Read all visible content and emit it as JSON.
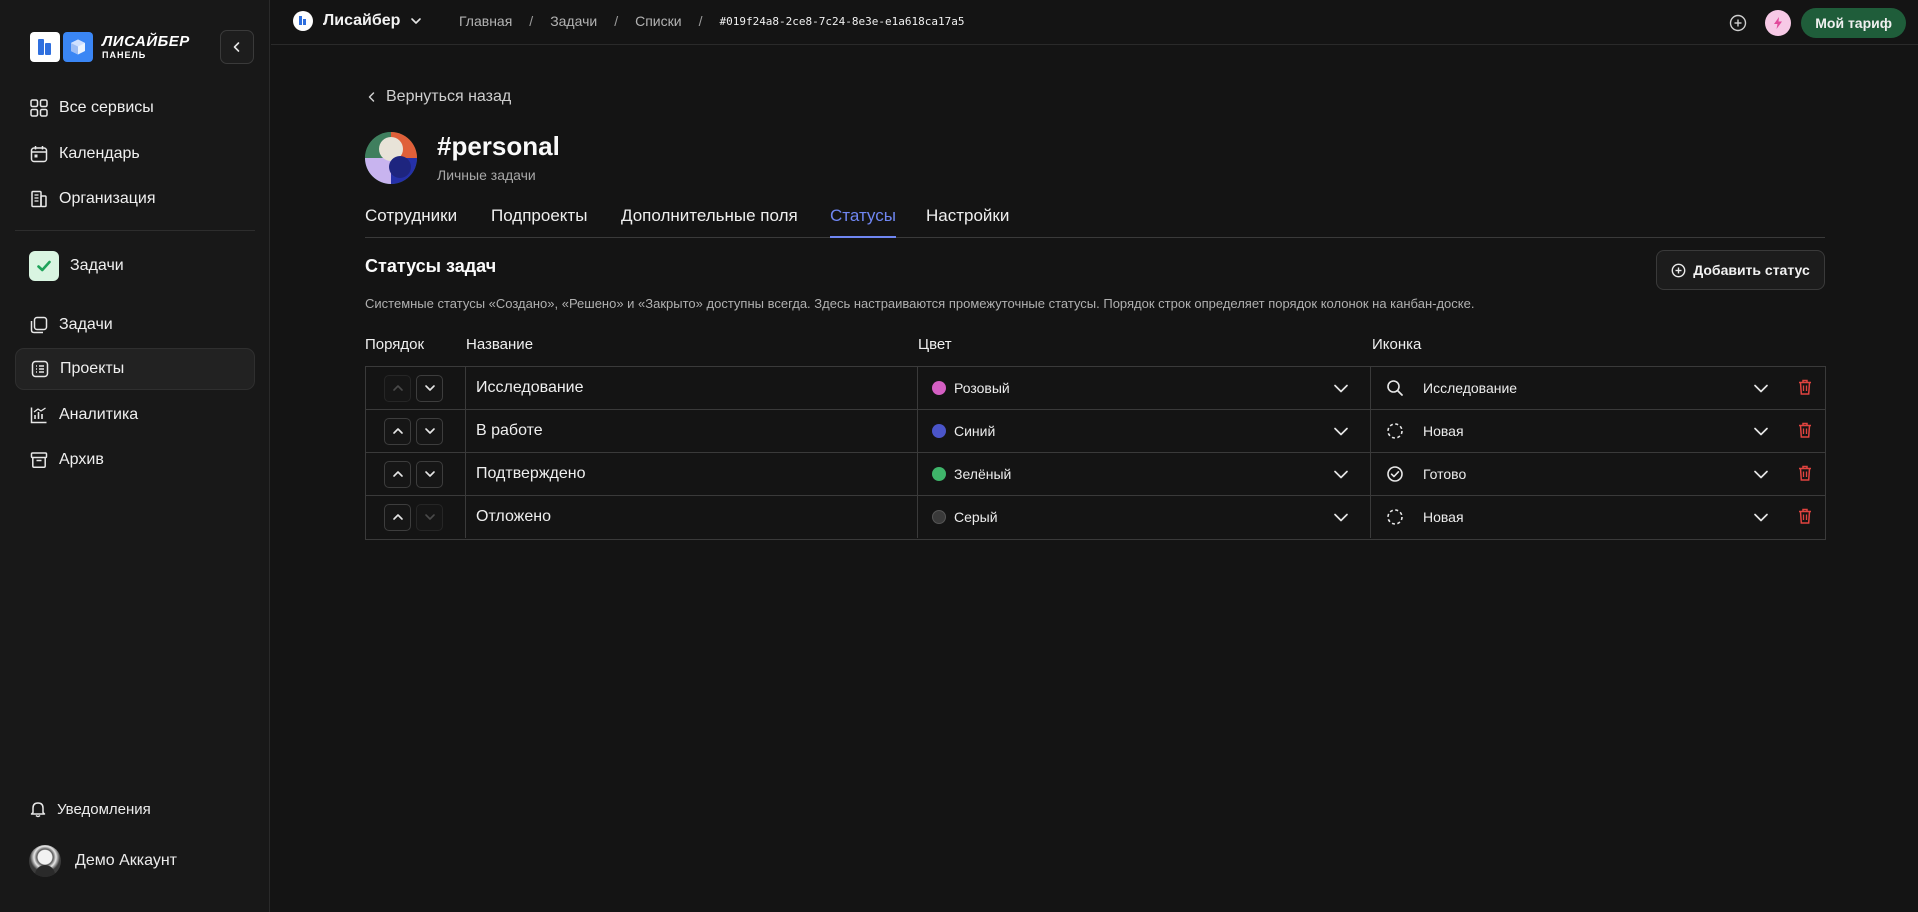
{
  "sidebar": {
    "logo": {
      "line1": "ЛИСАЙБЕР",
      "line2": "ПАНЕЛЬ"
    },
    "items_top": [
      {
        "label": "Все сервисы",
        "icon": "grid-icon"
      },
      {
        "label": "Календарь",
        "icon": "calendar-icon"
      },
      {
        "label": "Организация",
        "icon": "building-icon"
      }
    ],
    "section_label": "Задачи",
    "items_tasks": [
      {
        "label": "Задачи",
        "icon": "tasks-icon"
      },
      {
        "label": "Проекты",
        "icon": "list-icon",
        "active": true
      },
      {
        "label": "Аналитика",
        "icon": "chart-icon"
      },
      {
        "label": "Архив",
        "icon": "archive-icon"
      }
    ],
    "notifications": "Уведомления",
    "account": "Демо Аккаунт"
  },
  "topbar": {
    "workspace": "Лисайбер",
    "breadcrumbs": [
      "Главная",
      "Задачи",
      "Списки"
    ],
    "breadcrumb_id": "#019f24a8-2ce8-7c24-8e3e-e1a618ca17a5",
    "plan_button": "Мой тариф"
  },
  "main": {
    "back": "Вернуться назад",
    "project_title": "#personal",
    "project_subtitle": "Личные задачи",
    "tabs": [
      "Сотрудники",
      "Подпроекты",
      "Дополнительные поля",
      "Статусы",
      "Настройки"
    ],
    "active_tab": "Статусы",
    "section_title": "Статусы задач",
    "add_button": "Добавить статус",
    "hint": "Системные статусы «Создано», «Решено» и «Закрыто» доступны всегда. Здесь настраиваются промежуточные статусы. Порядок строк определяет порядок колонок на канбан-доске.",
    "columns": {
      "order": "Порядок",
      "name": "Название",
      "color": "Цвет",
      "icon": "Иконка"
    },
    "rows": [
      {
        "name": "Исследование",
        "color_label": "Розовый",
        "color": "#d45fc3",
        "icon_label": "Исследование",
        "icon": "search-icon",
        "up_enabled": false,
        "down_enabled": true
      },
      {
        "name": "В работе",
        "color_label": "Синий",
        "color": "#4b55c9",
        "icon_label": "Новая",
        "icon": "dashed-circle-icon",
        "up_enabled": true,
        "down_enabled": true
      },
      {
        "name": "Подтверждено",
        "color_label": "Зелёный",
        "color": "#3fb56a",
        "icon_label": "Готово",
        "icon": "check-circle-icon",
        "up_enabled": true,
        "down_enabled": true
      },
      {
        "name": "Отложено",
        "color_label": "Серый",
        "color": "#3a3a3a",
        "icon_label": "Новая",
        "icon": "dashed-circle-icon",
        "up_enabled": true,
        "down_enabled": false
      }
    ]
  },
  "colors": {
    "accent": "#6f86f2",
    "plan_bg": "#1f5d3a",
    "danger": "#e0433f"
  }
}
